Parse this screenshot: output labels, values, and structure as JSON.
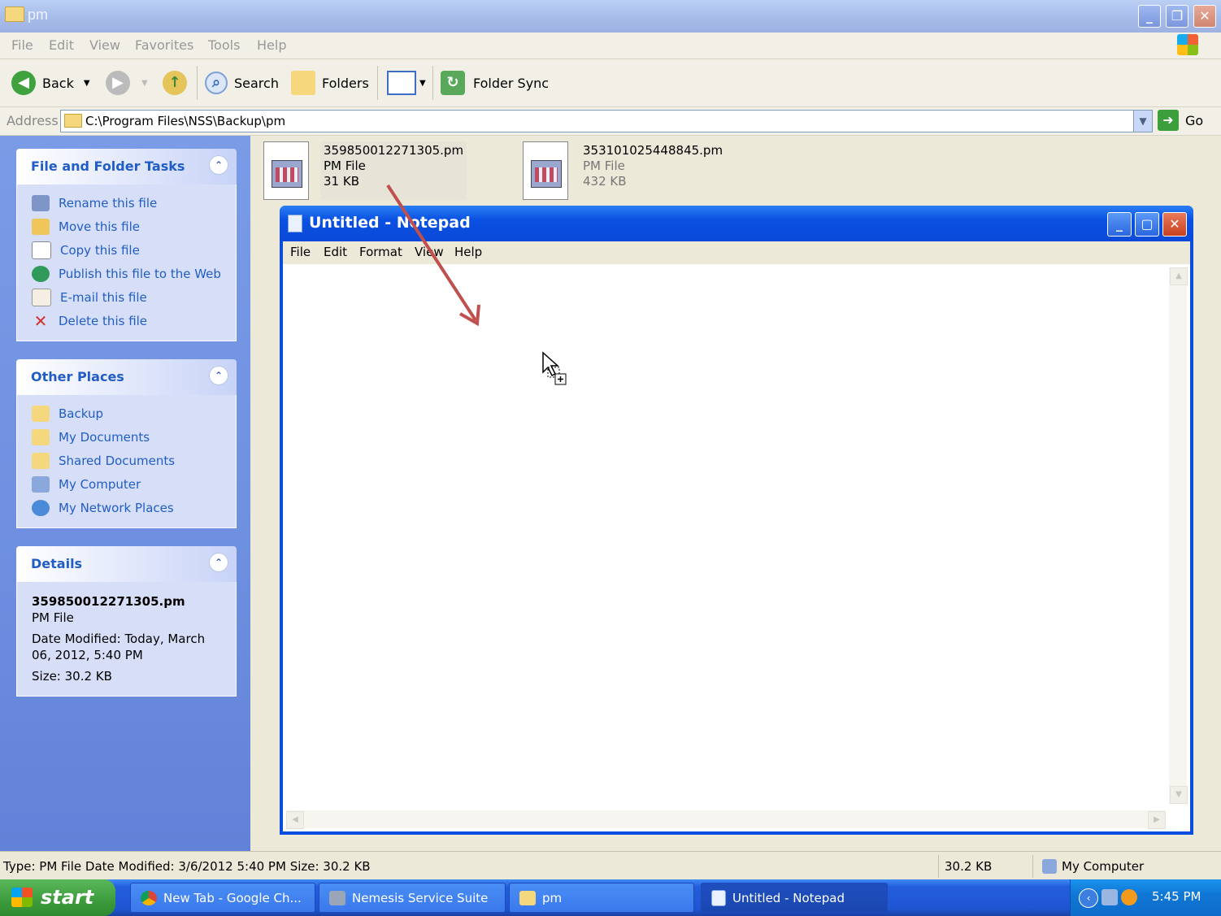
{
  "window": {
    "title": "pm"
  },
  "menu": [
    "File",
    "Edit",
    "View",
    "Favorites",
    "Tools",
    "Help"
  ],
  "toolbar": {
    "back": "Back",
    "search": "Search",
    "folders": "Folders",
    "folder_sync": "Folder Sync"
  },
  "address": {
    "label": "Address",
    "path": "C:\\Program Files\\NSS\\Backup\\pm",
    "go": "Go"
  },
  "tasks": {
    "title": "File and Folder Tasks",
    "items": [
      "Rename this file",
      "Move this file",
      "Copy this file",
      "Publish this file to the Web",
      "E-mail this file",
      "Delete this file"
    ]
  },
  "places": {
    "title": "Other Places",
    "items": [
      "Backup",
      "My Documents",
      "Shared Documents",
      "My Computer",
      "My Network Places"
    ]
  },
  "details": {
    "title": "Details",
    "name": "359850012271305.pm",
    "type": "PM File",
    "date_line1": "Date Modified: Today, March",
    "date_line2": "06, 2012, 5:40 PM",
    "size": "Size: 30.2 KB"
  },
  "files": [
    {
      "name": "359850012271305.pm",
      "type": "PM File",
      "size": "31 KB"
    },
    {
      "name": "353101025448845.pm",
      "type": "PM File",
      "size": "432 KB"
    }
  ],
  "notepad": {
    "title": "Untitled - Notepad",
    "menu": [
      "File",
      "Edit",
      "Format",
      "View",
      "Help"
    ]
  },
  "status": {
    "text": "Type: PM File Date Modified: 3/6/2012 5:40 PM Size: 30.2 KB",
    "size": "30.2 KB",
    "zone": "My Computer"
  },
  "taskbar": {
    "start": "start",
    "buttons": [
      "New Tab - Google Ch...",
      "Nemesis Service Suite",
      "pm",
      "Untitled - Notepad"
    ],
    "clock": "5:45 PM"
  },
  "colors": {
    "annotation_arrow": "#c0504d",
    "taskbar": "#245edb",
    "link": "#215dc6"
  }
}
